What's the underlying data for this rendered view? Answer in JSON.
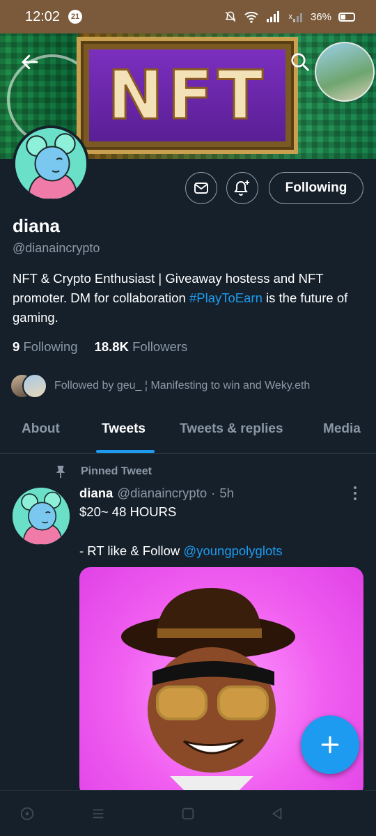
{
  "status_bar": {
    "time": "12:02",
    "notif_count": "21",
    "battery": "36%",
    "sim_mark": "x"
  },
  "banner": {
    "text": "NFT"
  },
  "actions": {
    "following_label": "Following"
  },
  "profile": {
    "name": "diana",
    "handle": "@dianaincrypto",
    "bio_part1": "NFT & Crypto Enthusiast | Giveaway hostess and NFT promoter. DM for collaboration ",
    "bio_hashtag": "#PlayToEarn",
    "bio_part2": " is the future of gaming.",
    "following_count": "9",
    "following_label": "Following",
    "followers_count": "18.8K",
    "followers_label": "Followers",
    "followed_by": "Followed by geu_ ¦ Manifesting to win and Weky.eth"
  },
  "tabs": [
    {
      "label": "About"
    },
    {
      "label": "Tweets"
    },
    {
      "label": "Tweets & replies"
    },
    {
      "label": "Media"
    }
  ],
  "tweet": {
    "pinned_label": "Pinned Tweet",
    "author_name": "diana",
    "author_handle": "@dianaincrypto",
    "separator": "·",
    "time": "5h",
    "line1": "$20~ 48 HOURS",
    "line2_prefix": "- RT like & Follow ",
    "line2_mention": "@youngpolyglots"
  },
  "icons": {
    "back": "arrow-left-icon",
    "search": "search-icon",
    "message": "envelope-icon",
    "bell": "bell-plus-icon",
    "pin": "pin-icon",
    "more": "more-vertical-icon",
    "compose": "plus-icon"
  },
  "colors": {
    "accent": "#1d9bf0",
    "background": "#15202b",
    "muted": "#8b98a5",
    "status_bar": "#7a5a3a"
  }
}
